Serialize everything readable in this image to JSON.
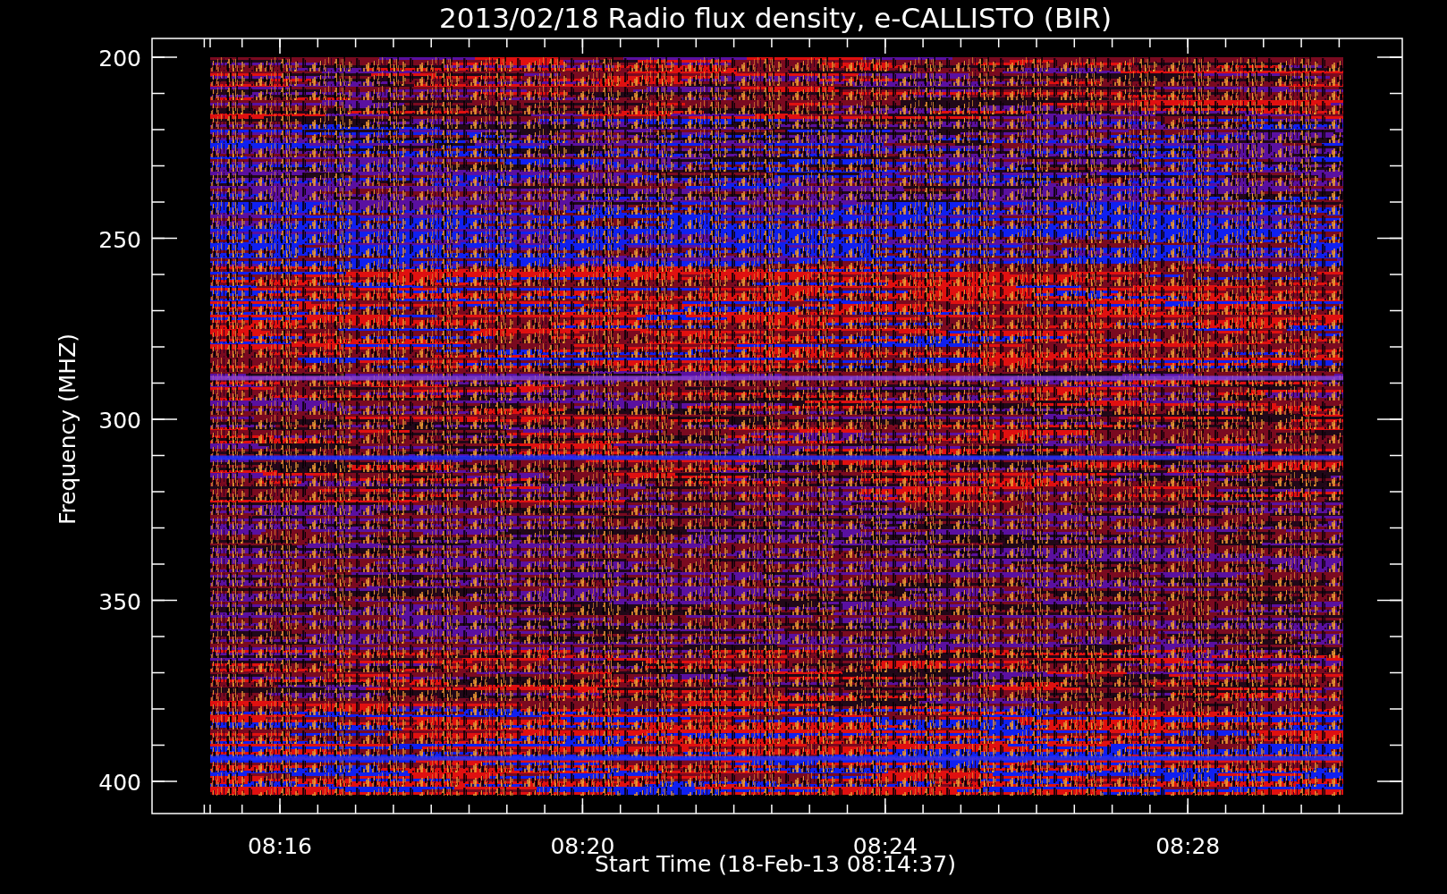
{
  "title": "2013/02/18  Radio flux density, e-CALLISTO (BIR)",
  "y_axis": {
    "label": "Frequency (MHZ)",
    "ticks": [
      "200",
      "250",
      "300",
      "350",
      "400"
    ]
  },
  "x_axis": {
    "label": "Start Time (18-Feb-13 08:14:37)",
    "ticks": [
      "08:16",
      "08:20",
      "08:24",
      "08:28"
    ]
  }
}
